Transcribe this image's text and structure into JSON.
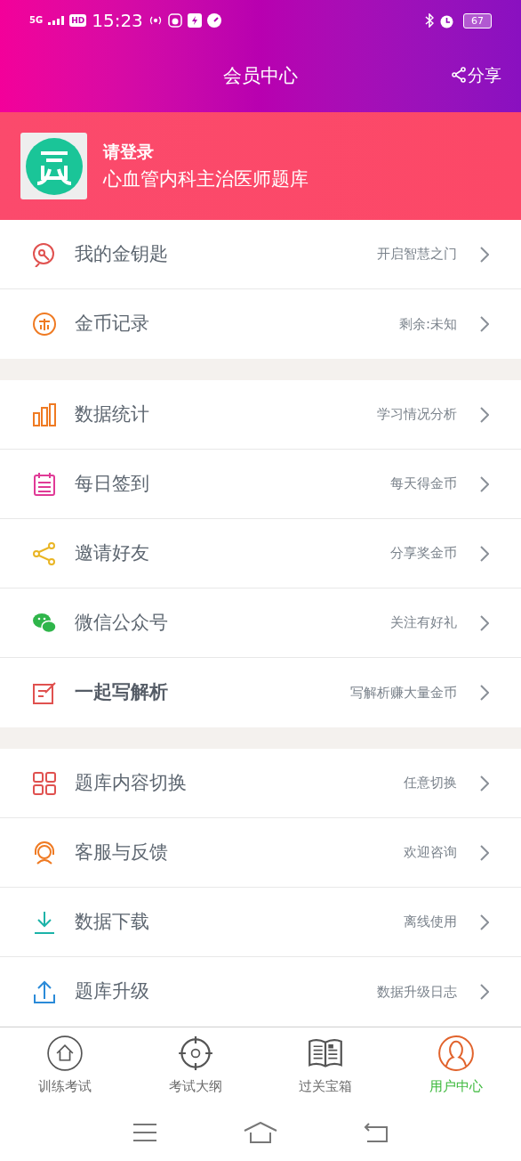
{
  "status_bar": {
    "network": "5G",
    "hd": "HD",
    "time": "15:23",
    "battery": "67"
  },
  "header": {
    "title": "会员中心",
    "share": "分享"
  },
  "profile": {
    "login": "请登录",
    "bank": "心血管内科主治医师题库"
  },
  "menu_groups": [
    [
      {
        "label": "我的金钥匙",
        "hint": "开启智慧之门",
        "emphasized": false
      },
      {
        "label": "金币记录",
        "hint": "剩余:未知",
        "emphasized": false
      }
    ],
    [
      {
        "label": "数据统计",
        "hint": "学习情况分析",
        "emphasized": false
      },
      {
        "label": "每日签到",
        "hint": "每天得金币",
        "emphasized": false
      },
      {
        "label": "邀请好友",
        "hint": "分享奖金币",
        "emphasized": false
      },
      {
        "label": "微信公众号",
        "hint": "关注有好礼",
        "emphasized": false
      },
      {
        "label": "一起写解析",
        "hint": "写解析赚大量金币",
        "emphasized": true
      }
    ],
    [
      {
        "label": "题库内容切换",
        "hint": "任意切换",
        "emphasized": false
      },
      {
        "label": "客服与反馈",
        "hint": "欢迎咨询",
        "emphasized": false
      },
      {
        "label": "数据下载",
        "hint": "离线使用",
        "emphasized": false
      },
      {
        "label": "题库升级",
        "hint": "数据升级日志",
        "emphasized": false
      }
    ]
  ],
  "tabs": [
    {
      "label": "训练考试",
      "selected": false
    },
    {
      "label": "考试大纲",
      "selected": false
    },
    {
      "label": "过关宝箱",
      "selected": false
    },
    {
      "label": "用户中心",
      "selected": true
    }
  ]
}
